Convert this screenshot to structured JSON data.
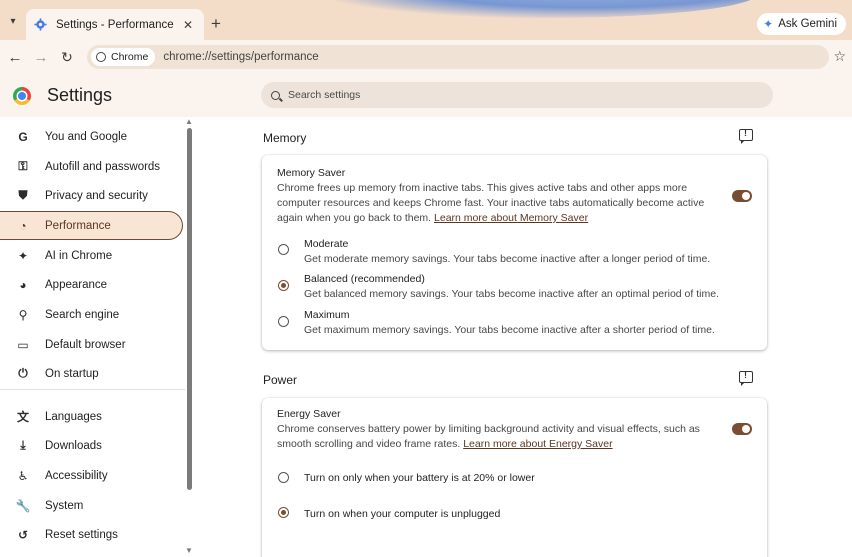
{
  "browser": {
    "tab_title": "Settings - Performance",
    "tab_close": "✕",
    "new_tab": "+",
    "gemini_label": "Ask Gemini",
    "chip_label": "Chrome",
    "url": "chrome://settings/performance"
  },
  "header": {
    "title": "Settings",
    "search_placeholder": "Search settings"
  },
  "sidebar": {
    "items": [
      {
        "label": "You and Google",
        "icon": "google-icon"
      },
      {
        "label": "Autofill and passwords",
        "icon": "key-icon"
      },
      {
        "label": "Privacy and security",
        "icon": "shield-icon"
      },
      {
        "label": "Performance",
        "icon": "speedometer-icon",
        "active": true
      },
      {
        "label": "AI in Chrome",
        "icon": "sparkle-icon"
      },
      {
        "label": "Appearance",
        "icon": "palette-icon"
      },
      {
        "label": "Search engine",
        "icon": "search-icon"
      },
      {
        "label": "Default browser",
        "icon": "browser-window-icon"
      },
      {
        "label": "On startup",
        "icon": "power-icon"
      },
      {
        "label": "Languages",
        "icon": "translate-icon"
      },
      {
        "label": "Downloads",
        "icon": "download-icon"
      },
      {
        "label": "Accessibility",
        "icon": "accessibility-icon"
      },
      {
        "label": "System",
        "icon": "wrench-icon"
      },
      {
        "label": "Reset settings",
        "icon": "reset-icon"
      }
    ]
  },
  "memory": {
    "section_title": "Memory",
    "card_title": "Memory Saver",
    "description": "Chrome frees up memory from inactive tabs. This gives active tabs and other apps more computer resources and keeps Chrome fast. Your inactive tabs automatically become active again when you go back to them.",
    "link": "Learn more about Memory Saver",
    "enabled": true,
    "options": [
      {
        "label": "Moderate",
        "sub": "Get moderate memory savings. Your tabs become inactive after a longer period of time.",
        "checked": false
      },
      {
        "label": "Balanced (recommended)",
        "sub": "Get balanced memory savings. Your tabs become inactive after an optimal period of time.",
        "checked": true
      },
      {
        "label": "Maximum",
        "sub": "Get maximum memory savings. Your tabs become inactive after a shorter period of time.",
        "checked": false
      }
    ]
  },
  "power": {
    "section_title": "Power",
    "card_title": "Energy Saver",
    "description": "Chrome conserves battery power by limiting background activity and visual effects, such as smooth scrolling and video frame rates.",
    "link": "Learn more about Energy Saver",
    "enabled": true,
    "options": [
      {
        "label": "Turn on only when your battery is at 20% or lower",
        "checked": false
      },
      {
        "label": "Turn on when your computer is unplugged",
        "checked": true
      }
    ]
  },
  "colors": {
    "accent": "#7a4c33",
    "active_nav_bg": "#f9e5d3",
    "frame": "#f3dcc8"
  }
}
